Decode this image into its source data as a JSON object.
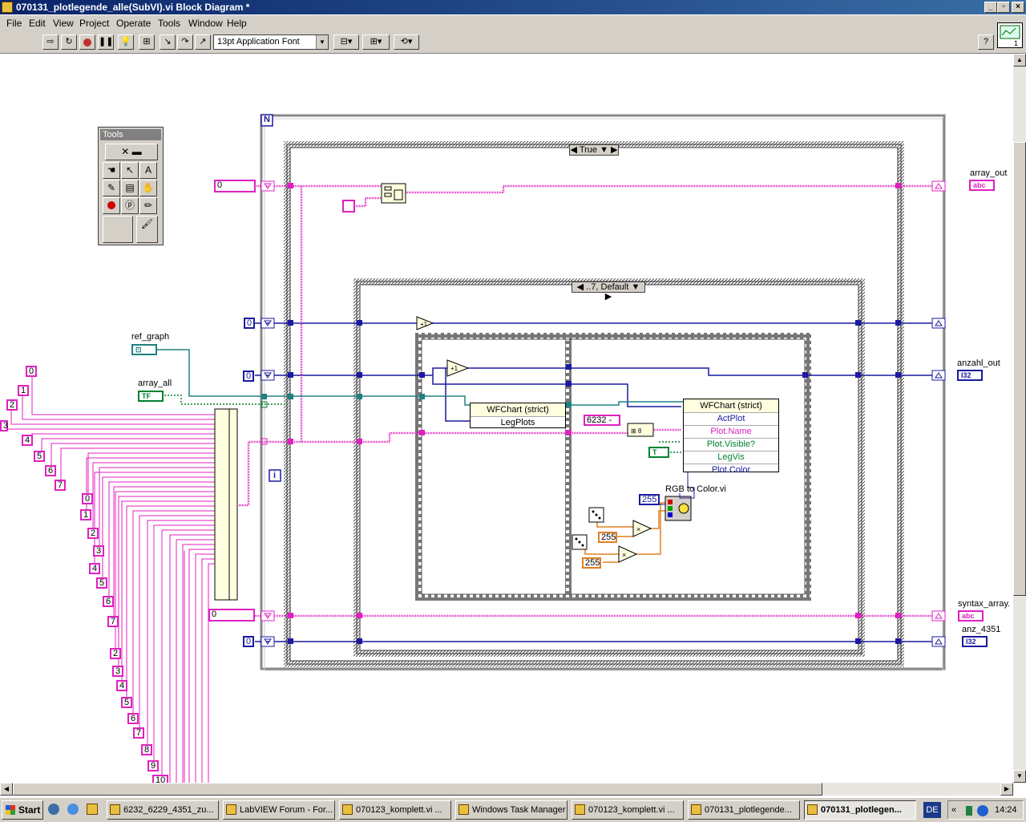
{
  "window": {
    "title": "070131_plotlegende_alle(SubVI).vi Block Diagram *"
  },
  "menu": [
    "File",
    "Edit",
    "View",
    "Project",
    "Operate",
    "Tools",
    "Window",
    "Help"
  ],
  "toolbar": {
    "font": "13pt Application Font"
  },
  "tools_palette": {
    "title": "Tools"
  },
  "diagram": {
    "for_loop_count": "N",
    "for_loop_index": "i",
    "case_outer": "True",
    "case_inner": "..7, Default",
    "labels": {
      "ref_graph": "ref_graph",
      "array_all": "array_all",
      "array_out": "array_out",
      "anzahl_out": "anzahl_out",
      "syntax_array": "syntax_array.",
      "anz_4351": "anz_4351",
      "rgb_to_color": "RGB to Color.vi"
    },
    "terminals": {
      "array_all": "TF",
      "array_out": "abc",
      "anzahl_out": "I32",
      "syntax_array": "abc",
      "anz_4351": "I32",
      "legvis": "T"
    },
    "constants": {
      "zero_top": "0",
      "zero_mid1": "0",
      "zero_mid2": "0",
      "zero_bottom_str": "0",
      "zero_bottom": "0",
      "string_6232": "6232 -",
      "c255_a": "255",
      "c255_b": "255",
      "c255_c": "255"
    },
    "left_constants": [
      "0",
      "1",
      "2",
      "3",
      "4",
      "5",
      "6",
      "7",
      "0",
      "1",
      "2",
      "3",
      "4",
      "5",
      "6",
      "7",
      "2",
      "3",
      "4",
      "5",
      "6",
      "7",
      "8",
      "9",
      "10"
    ],
    "property_node_1": {
      "title": "WFChart (strict)",
      "rows": [
        "LegPlots"
      ]
    },
    "property_node_2": {
      "title": "WFChart (strict)",
      "rows": [
        "ActPlot",
        "Plot.Name",
        "Plot.Visible?",
        "LegVis",
        "Plot.Color"
      ]
    }
  },
  "taskbar": {
    "start": "Start",
    "tasks": [
      "6232_6229_4351_zu...",
      "LabVIEW Forum - For...",
      "070123_komplett.vi ...",
      "Windows Task Manager",
      "070123_komplett.vi ...",
      "070131_plotlegende...",
      "070131_plotlegen..."
    ],
    "lang": "DE",
    "clock": "14:24"
  }
}
